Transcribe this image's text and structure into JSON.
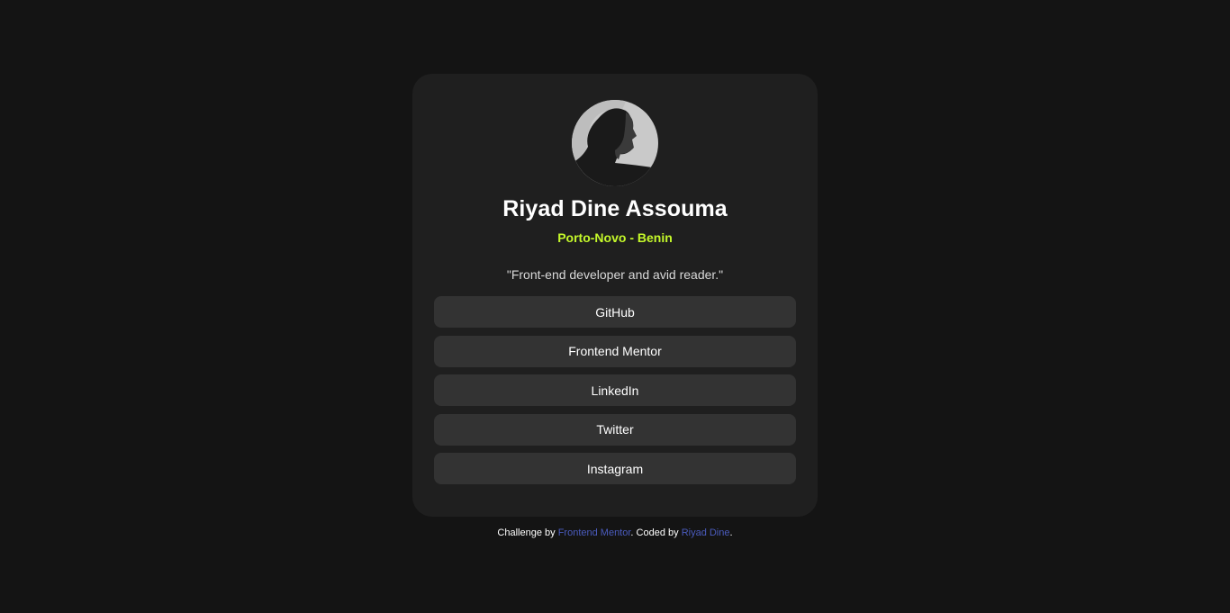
{
  "profile": {
    "name": "Riyad Dine Assouma",
    "location": "Porto-Novo - Benin",
    "bio": "\"Front-end developer and avid reader.\""
  },
  "links": [
    {
      "label": "GitHub"
    },
    {
      "label": "Frontend Mentor"
    },
    {
      "label": "LinkedIn"
    },
    {
      "label": "Twitter"
    },
    {
      "label": "Instagram"
    }
  ],
  "attribution": {
    "prefix": "Challenge by ",
    "challenge_link": "Frontend Mentor",
    "middle": ". Coded by ",
    "author_link": "Riyad Dine",
    "suffix": "."
  },
  "colors": {
    "background": "#141414",
    "card": "#1f1f1f",
    "button": "#333333",
    "accent": "#c4f82a",
    "link": "#4a5bbd"
  }
}
